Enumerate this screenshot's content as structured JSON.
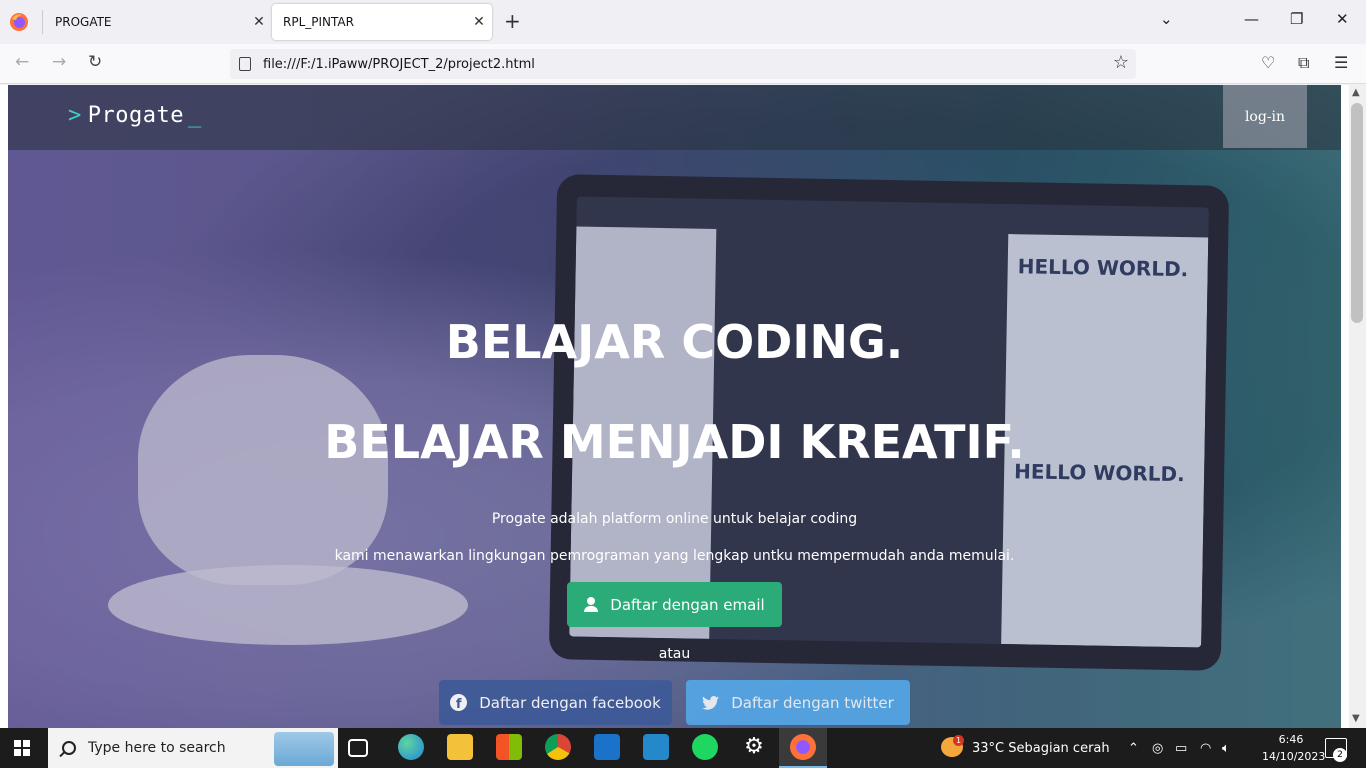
{
  "browser": {
    "tabs": [
      {
        "title": "PROGATE",
        "active": false
      },
      {
        "title": "RPL_PINTAR",
        "active": true
      }
    ],
    "url": "file:///F:/1.iPaww/PROJECT_2/project2.html"
  },
  "page": {
    "logo": "Progate",
    "logo_prefix": ">",
    "logo_suffix": "_",
    "login_label": "log-in",
    "headline_1": "BELAJAR CODING.",
    "headline_2": "BELAJAR MENJADI KREATIF.",
    "description_1": "Progate adalah platform online untuk belajar coding",
    "description_2": "kami menawarkan lingkungan pemrograman yang lengkap untku mempermudah anda memulai.",
    "email_button": "Daftar dengan email",
    "or_text": "atau",
    "facebook_button": "Daftar dengan facebook",
    "twitter_button": "Daftar dengan twitter",
    "laptop_screen_text": "HELLO WORLD.",
    "laptop_screen_text_2": "HELLO WORLD.",
    "colors": {
      "email_button": "#2bab78",
      "facebook_button": "#3d5a98",
      "twitter_button": "#55acee",
      "logo_accent": "#3ed1c3"
    }
  },
  "taskbar": {
    "search_placeholder": "Type here to search",
    "weather": "33°C  Sebagian cerah",
    "weather_badge": "1",
    "time": "6:46",
    "date": "14/10/2023",
    "notification_count": "2",
    "apps": [
      "task-view-icon",
      "edge-icon",
      "file-explorer-icon",
      "store-icon",
      "chrome-icon",
      "mail-icon",
      "vscode-icon",
      "spotify-icon",
      "settings-icon",
      "firefox-icon"
    ]
  }
}
